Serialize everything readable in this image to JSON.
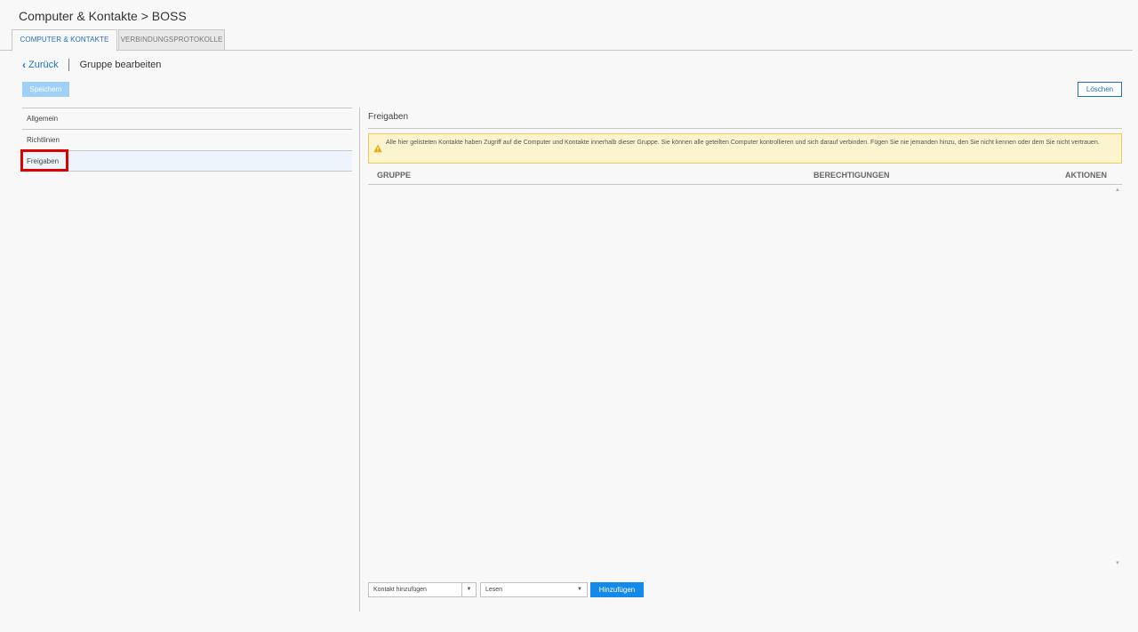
{
  "header": {
    "title": "Computer & Kontakte > BOSS"
  },
  "tabs": [
    {
      "label": "COMPUTER & KONTAKTE",
      "active": true
    },
    {
      "label": "VERBINDUNGSPROTOKOLLE",
      "active": false
    }
  ],
  "nav": {
    "back_label": "Zurück",
    "breadcrumb": "Gruppe bearbeiten"
  },
  "toolbar": {
    "save_label": "Speichern",
    "delete_label": "Löschen"
  },
  "sidebar": {
    "items": [
      {
        "label": "Allgemein"
      },
      {
        "label": "Richtlinien"
      },
      {
        "label": "Freigaben",
        "selected": true
      }
    ]
  },
  "main": {
    "section_title": "Freigaben",
    "warning_text": "Alle hier gelisteten Kontakte haben Zugriff auf die Computer und Kontakte innerhalb dieser Gruppe. Sie können alle geteilten Computer kontrollieren und sich darauf verbinden. Fügen Sie nie jemanden hinzu, den Sie nicht kennen oder dem Sie nicht vertrauen.",
    "table": {
      "headers": [
        "GRUPPE",
        "BERECHTIGUNGEN",
        "AKTIONEN"
      ],
      "rows": []
    },
    "add_bar": {
      "contact_placeholder": "Kontakt hinzufügen",
      "permission_value": "Lesen",
      "add_label": "Hinzufügen"
    }
  },
  "colors": {
    "accent": "#1e6fc0",
    "primary_button": "#1589e8",
    "warning_bg": "#fcf3cf",
    "highlight": "#e00000"
  }
}
